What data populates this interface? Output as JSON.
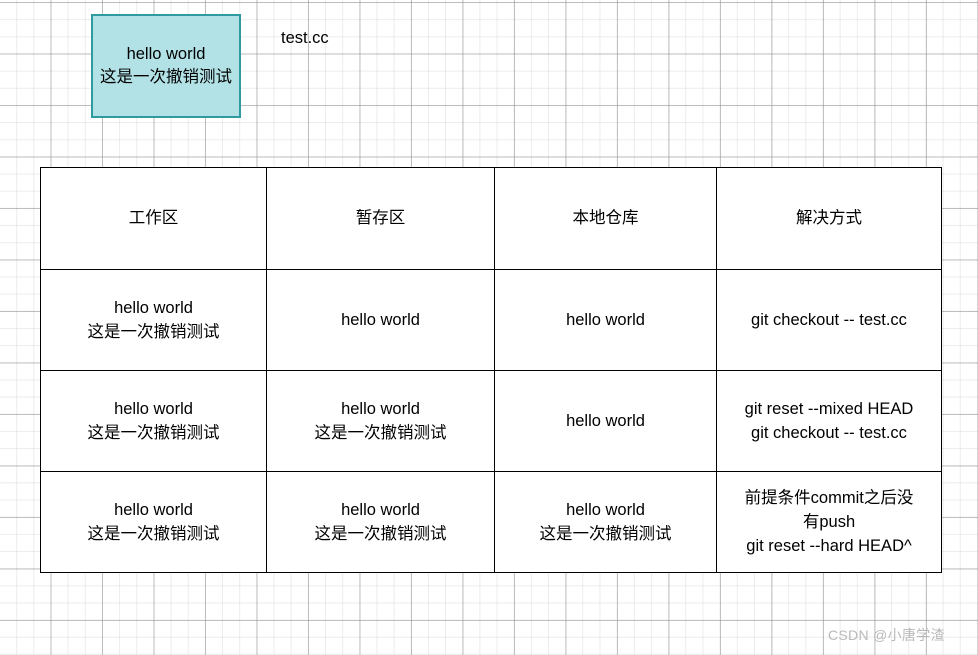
{
  "canvas": {
    "background": "#ffffff",
    "grid_minor_color": "#f0f0f0",
    "grid_major_color": "#c8c8c8"
  },
  "note_box": {
    "fill_color": "#b2e2e6",
    "border_color": "#2f9a9f",
    "line1": "hello world",
    "line2": "这是一次撤销测试"
  },
  "file_label": "test.cc",
  "table": {
    "headers": [
      "工作区",
      "暂存区",
      "本地仓库",
      "解决方式"
    ],
    "rows": [
      {
        "work": [
          "hello world",
          "这是一次撤销测试"
        ],
        "stage": [
          "hello world"
        ],
        "repo": [
          "hello world"
        ],
        "fix": [
          "git checkout -- test.cc"
        ]
      },
      {
        "work": [
          "hello world",
          "这是一次撤销测试"
        ],
        "stage": [
          "hello world",
          "这是一次撤销测试"
        ],
        "repo": [
          "hello world"
        ],
        "fix": [
          "git reset --mixed HEAD",
          "git checkout -- test.cc"
        ]
      },
      {
        "work": [
          "hello world",
          "这是一次撤销测试"
        ],
        "stage": [
          "hello world",
          "这是一次撤销测试"
        ],
        "repo": [
          "hello world",
          "这是一次撤销测试"
        ],
        "fix": [
          "前提条件commit之后没",
          "有push",
          "git reset --hard HEAD^"
        ]
      }
    ]
  },
  "watermark": "CSDN @小唐学渣"
}
